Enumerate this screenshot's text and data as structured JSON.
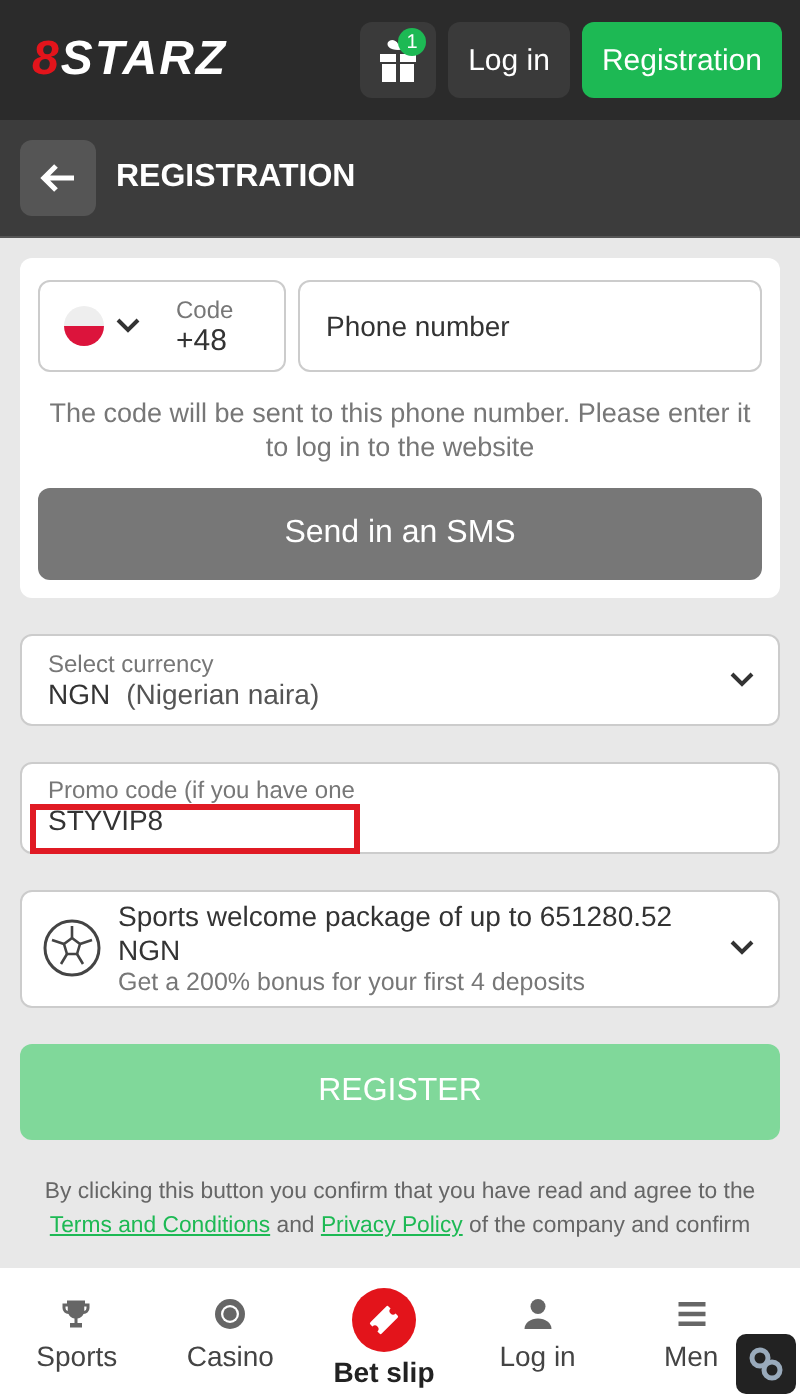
{
  "header": {
    "logo_mark": "8",
    "logo_text": "STARZ",
    "gift_badge": "1",
    "login_button": "Log in",
    "register_button": "Registration"
  },
  "page_title": "REGISTRATION",
  "phone": {
    "code_label": "Code",
    "code": "+48",
    "placeholder": "Phone number"
  },
  "hint": "The code will be sent to this phone number. Please enter it to log in to the website",
  "sms_button": "Send in an SMS",
  "currency": {
    "label": "Select currency",
    "code": "NGN",
    "name": "(Nigerian naira)"
  },
  "promo": {
    "label": "Promo code (if you have one",
    "value": "STYVIP8",
    "highlighted": true
  },
  "bonus": {
    "title": "Sports welcome package of up to 651280.52 NGN",
    "subtitle": "Get a 200% bonus for your first 4 deposits"
  },
  "register": {
    "label": "REGISTER",
    "disabled": true
  },
  "terms": {
    "before": "By clicking this button you confirm that you have read and agree to the",
    "link_1": "Terms and Conditions",
    "middle": "and",
    "link_2": "Privacy Policy",
    "after": "of the company and confirm"
  },
  "nav": [
    {
      "label": "Sports",
      "kind": "plain"
    },
    {
      "label": "Casino",
      "kind": "plain"
    },
    {
      "label": "Bet slip",
      "kind": "featured"
    },
    {
      "label": "Log in",
      "kind": "plain"
    },
    {
      "label": "Men",
      "kind": "plain"
    }
  ]
}
